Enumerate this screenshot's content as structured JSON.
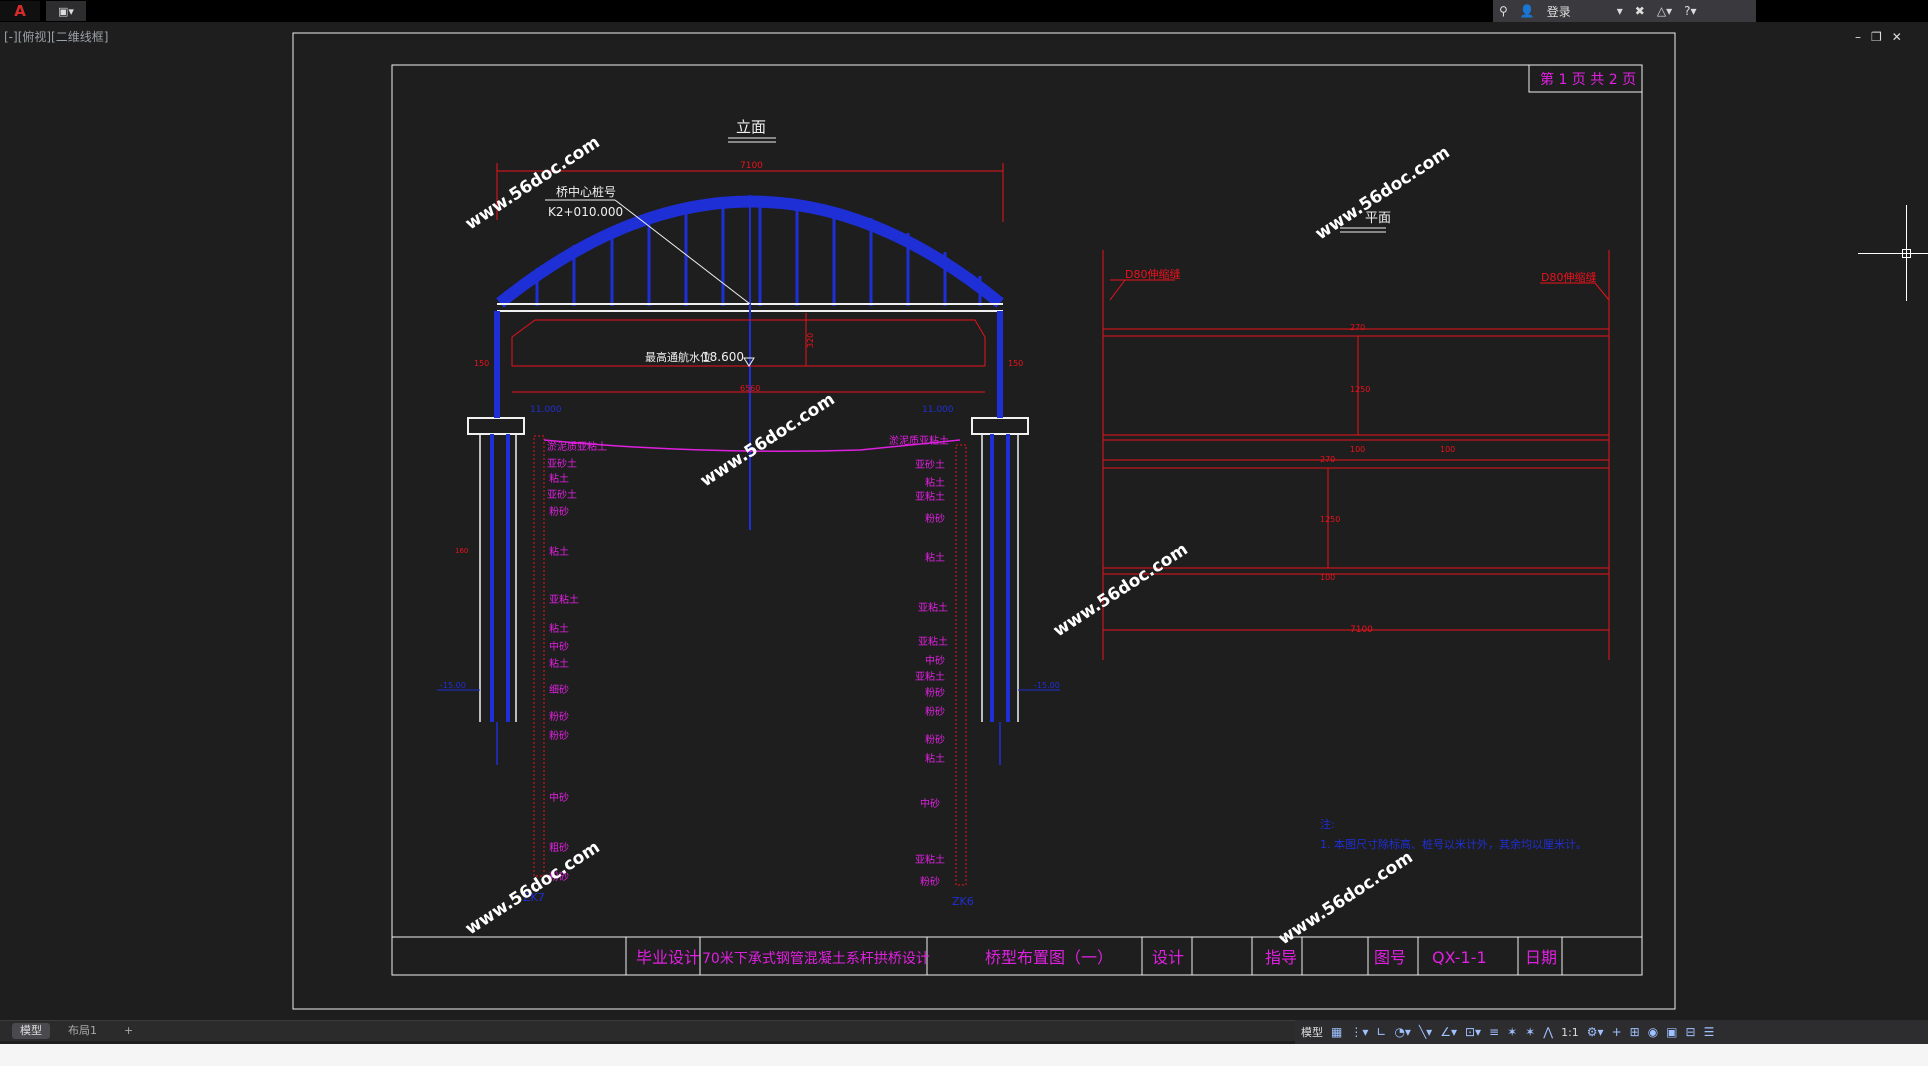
{
  "toolbar": {
    "app_logo": "A",
    "doc_icon": "doc-icon",
    "search": {
      "login_label": "登录"
    }
  },
  "viewport": {
    "view_label": "[-][俯视][二维线框]"
  },
  "drawing": {
    "sheet_label": "第 1 页  共 2 页",
    "elevation_title": "立面",
    "plan_title": "平面",
    "center_pile_label": "桥中心桩号",
    "center_pile_value": "K2+010.000",
    "span_total": "7100",
    "clear_span": "6560",
    "water_level_label": "最高通航水位",
    "water_level_value": "18.600",
    "left_offset": "150",
    "right_offset": "150",
    "rise_dim": "320",
    "left_top_elev": "11.000",
    "right_top_elev": "11.000",
    "left_tip_elev": "-15.00",
    "right_tip_elev": "-15.00",
    "pile_width": "160",
    "left_borehole": "ZK7",
    "right_borehole": "ZK6",
    "left_strata": [
      "淤泥质亚粘土",
      "亚砂土",
      "粘土",
      "亚砂土",
      "粉砂",
      "粘土",
      "亚粘土",
      "粘土",
      "中砂",
      "粘土",
      "细砂",
      "粉砂",
      "粉砂",
      "中砂",
      "粗砂",
      "粉砂"
    ],
    "right_strata": [
      "淤泥质亚粘土",
      "亚砂土",
      "粘土",
      "亚粘土",
      "粉砂",
      "粘土",
      "亚粘土",
      "亚粘土",
      "中砂",
      "亚粘土",
      "粉砂",
      "粉砂",
      "粉砂",
      "粘土",
      "中砂",
      "亚粘土",
      "粉砂"
    ],
    "plan_joint_left": "D80伸缩缝",
    "plan_joint_right": "D80伸缩缝",
    "plan_dims": [
      "270",
      "1250",
      "100",
      "100",
      "270",
      "1250",
      "100"
    ],
    "plan_span": "7100",
    "note_title": "注:",
    "note_text": "1. 本图尺寸除标高、桩号以米计外，其余均以厘米计。",
    "watermark": "www.56doc.com"
  },
  "titleblock": {
    "design_label": "毕业设计",
    "project_name": "70米下承式钢管混凝土系杆拱桥设计",
    "drawing_name": "桥型布置图（一）",
    "designer_label": "设计",
    "supervisor_label": "指导",
    "drawing_no_label": "图号",
    "drawing_no": "QX-1-1",
    "date_label": "日期"
  },
  "tabs": {
    "model": "模型",
    "layout1": "布局1",
    "add": "+"
  },
  "status": {
    "model_label": "模型",
    "scale": "1:1"
  },
  "colors": {
    "arch": "#1f2fd6",
    "dims": "#e8121c",
    "labels": "#e020e0",
    "frame": "#f0f0f0"
  }
}
